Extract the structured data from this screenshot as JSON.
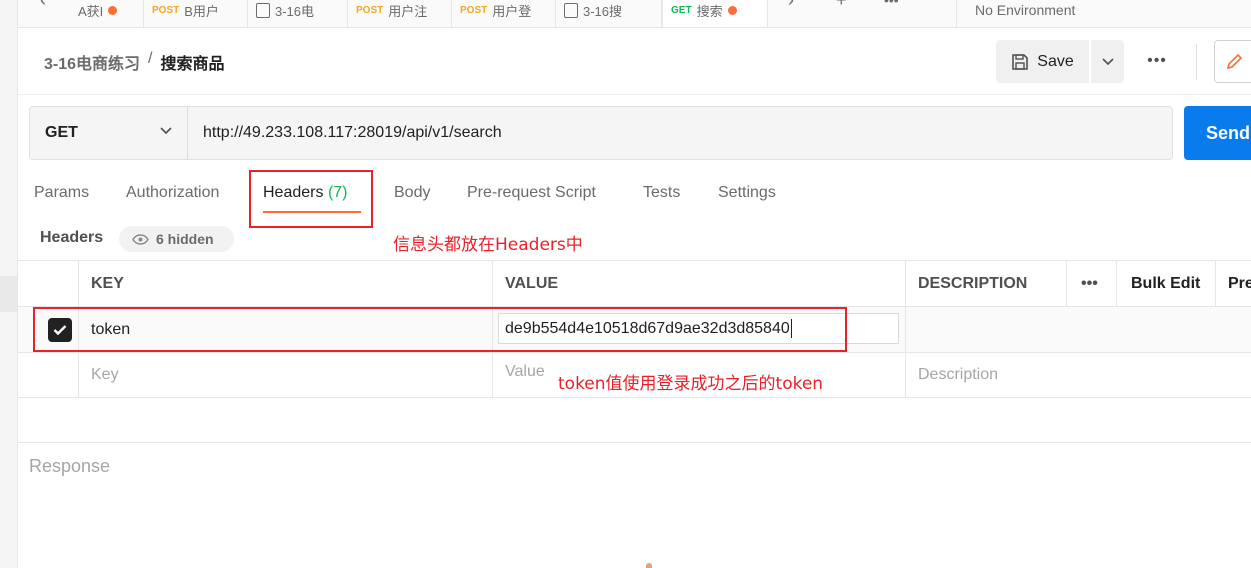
{
  "tabs": [
    {
      "method": "",
      "label": "A获I",
      "dot": true
    },
    {
      "method": "POST",
      "label": "B用户",
      "dot": false
    },
    {
      "method": "",
      "label": "3-16电",
      "doc": true
    },
    {
      "method": "POST",
      "label": "用户注",
      "dot": false
    },
    {
      "method": "POST",
      "label": "用户登",
      "dot": false
    },
    {
      "method": "",
      "label": "3-16搜",
      "doc": true
    },
    {
      "method": "GET",
      "label": "搜索",
      "dot": true
    }
  ],
  "environment": "No Environment",
  "breadcrumb": {
    "collection": "3-16电商练习",
    "separator": "/",
    "current": "搜索商品"
  },
  "toolbar": {
    "save_label": "Save",
    "more_label": "•••"
  },
  "request": {
    "method": "GET",
    "url": "http://49.233.108.117:28019/api/v1/search",
    "send_label": "Send"
  },
  "request_tabs": [
    {
      "label": "Params"
    },
    {
      "label": "Authorization"
    },
    {
      "label": "Headers",
      "count": "(7)",
      "active": true
    },
    {
      "label": "Body"
    },
    {
      "label": "Pre-request Script"
    },
    {
      "label": "Tests"
    },
    {
      "label": "Settings"
    }
  ],
  "headers_section": {
    "label": "Headers",
    "hidden_label": "6 hidden"
  },
  "annotations": {
    "headers_note": "信息头都放在Headers中",
    "token_note": "token值使用登录成功之后的token"
  },
  "table": {
    "columns": {
      "key": "KEY",
      "value": "VALUE",
      "description": "DESCRIPTION",
      "more": "•••",
      "bulk_edit": "Bulk Edit",
      "presets": "Pre"
    },
    "rows": [
      {
        "checked": true,
        "key": "token",
        "value": "de9b554d4e10518d67d9ae32d3d85840",
        "description": ""
      }
    ],
    "placeholders": {
      "key": "Key",
      "value": "Value",
      "description": "Description"
    }
  },
  "response": {
    "label": "Response"
  },
  "colors": {
    "accent": "#ff6c37",
    "send": "#097bed",
    "annotation": "#e8212a",
    "count": "#0cbb52"
  }
}
